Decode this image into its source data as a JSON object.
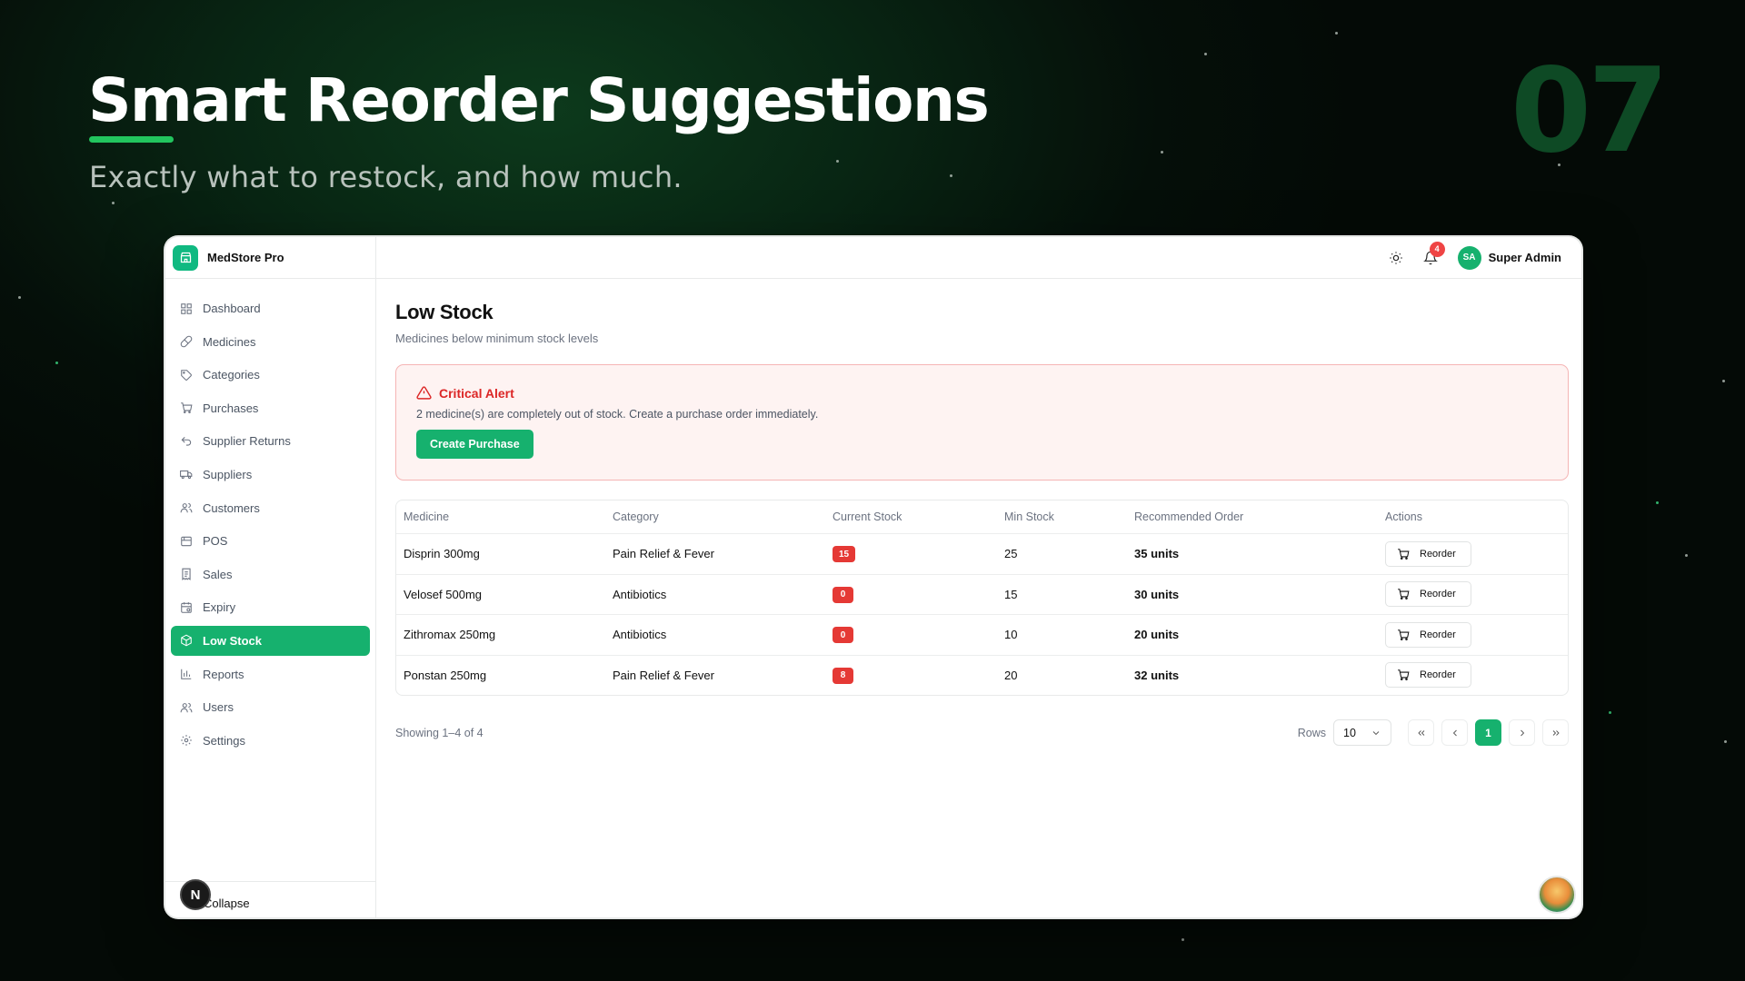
{
  "hero": {
    "title": "Smart Reorder Suggestions",
    "subtitle": "Exactly what to restock, and how much.",
    "number": "07"
  },
  "app": {
    "name": "MedStore Pro",
    "accent": "#16b16e"
  },
  "sidebar": {
    "items": [
      {
        "label": "Dashboard",
        "icon": "grid-icon"
      },
      {
        "label": "Medicines",
        "icon": "pill-icon"
      },
      {
        "label": "Categories",
        "icon": "tag-icon"
      },
      {
        "label": "Purchases",
        "icon": "cart-icon"
      },
      {
        "label": "Supplier Returns",
        "icon": "return-icon"
      },
      {
        "label": "Suppliers",
        "icon": "truck-icon"
      },
      {
        "label": "Customers",
        "icon": "users-icon"
      },
      {
        "label": "POS",
        "icon": "register-icon"
      },
      {
        "label": "Sales",
        "icon": "receipt-icon"
      },
      {
        "label": "Expiry",
        "icon": "calendar-icon"
      },
      {
        "label": "Low Stock",
        "icon": "package-icon",
        "active": true
      },
      {
        "label": "Reports",
        "icon": "bar-chart-icon"
      },
      {
        "label": "Users",
        "icon": "users-icon"
      },
      {
        "label": "Settings",
        "icon": "gear-icon"
      }
    ],
    "collapse_label": "Collapse",
    "badge_letter": "N"
  },
  "topbar": {
    "notification_count": "4",
    "user_initials": "SA",
    "user_name": "Super Admin"
  },
  "page": {
    "title": "Low Stock",
    "subtitle": "Medicines below minimum stock levels"
  },
  "alert": {
    "title": "Critical Alert",
    "message": "2 medicine(s) are completely out of stock. Create a purchase order immediately.",
    "button_label": "Create Purchase"
  },
  "table": {
    "columns": [
      "Medicine",
      "Category",
      "Current Stock",
      "Min Stock",
      "Recommended Order",
      "Actions"
    ],
    "rows": [
      {
        "medicine": "Disprin 300mg",
        "category": "Pain Relief & Fever",
        "current_stock": "15",
        "min_stock": "25",
        "recommended": "35 units",
        "action": "Reorder"
      },
      {
        "medicine": "Velosef 500mg",
        "category": "Antibiotics",
        "current_stock": "0",
        "min_stock": "15",
        "recommended": "30 units",
        "action": "Reorder"
      },
      {
        "medicine": "Zithromax 250mg",
        "category": "Antibiotics",
        "current_stock": "0",
        "min_stock": "10",
        "recommended": "20 units",
        "action": "Reorder"
      },
      {
        "medicine": "Ponstan 250mg",
        "category": "Pain Relief & Fever",
        "current_stock": "8",
        "min_stock": "20",
        "recommended": "32 units",
        "action": "Reorder"
      }
    ]
  },
  "footer": {
    "showing": "Showing 1–4 of 4",
    "rows_label": "Rows",
    "rows_value": "10",
    "current_page": "1"
  }
}
